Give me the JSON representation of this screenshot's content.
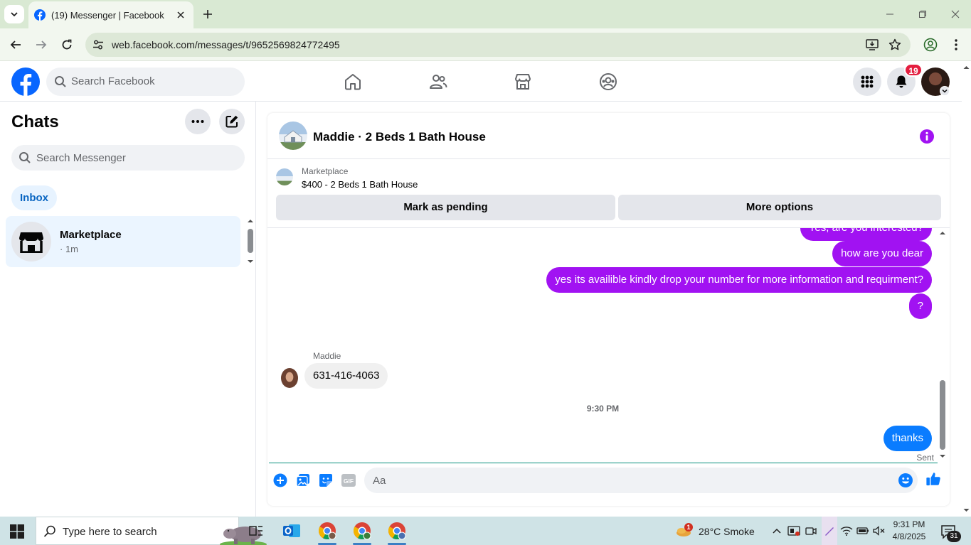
{
  "browser": {
    "tab_title": "(19) Messenger | Facebook",
    "url": "web.facebook.com/messages/t/9652569824772495"
  },
  "header": {
    "search_placeholder": "Search Facebook",
    "notification_count": "19"
  },
  "sidebar": {
    "title": "Chats",
    "search_placeholder": "Search Messenger",
    "filter_label": "Inbox",
    "chats": [
      {
        "name": "Marketplace",
        "time": "· 1m"
      }
    ]
  },
  "conversation": {
    "title": "Maddie · 2 Beds 1 Bath House",
    "marketplace_label": "Marketplace",
    "listing": "$400 - 2 Beds 1 Bath House",
    "mark_pending_label": "Mark as pending",
    "more_options_label": "More options",
    "messages": [
      {
        "text": "Yes, are you interested?",
        "color": "purple"
      },
      {
        "text": "how are you dear",
        "color": "purple"
      },
      {
        "text": "yes its availible kindly drop your number for more information and requirment?",
        "color": "purple"
      },
      {
        "text": "?",
        "color": "purple"
      }
    ],
    "incoming_sender": "Maddie",
    "incoming_text": "631-416-4063",
    "timestamp": "9:30 PM",
    "last_sent_text": "thanks",
    "sent_status": "Sent",
    "composer_placeholder": "Aa"
  },
  "colors": {
    "messenger_purple": "#a112f2",
    "messenger_blue": "#0a7cff",
    "facebook_blue": "#0866ff"
  },
  "taskbar": {
    "search_placeholder": "Type here to search",
    "weather": "28°C  Smoke",
    "weather_alert_count": "1",
    "time": "9:31 PM",
    "date": "4/8/2025",
    "notification_count": "31"
  }
}
